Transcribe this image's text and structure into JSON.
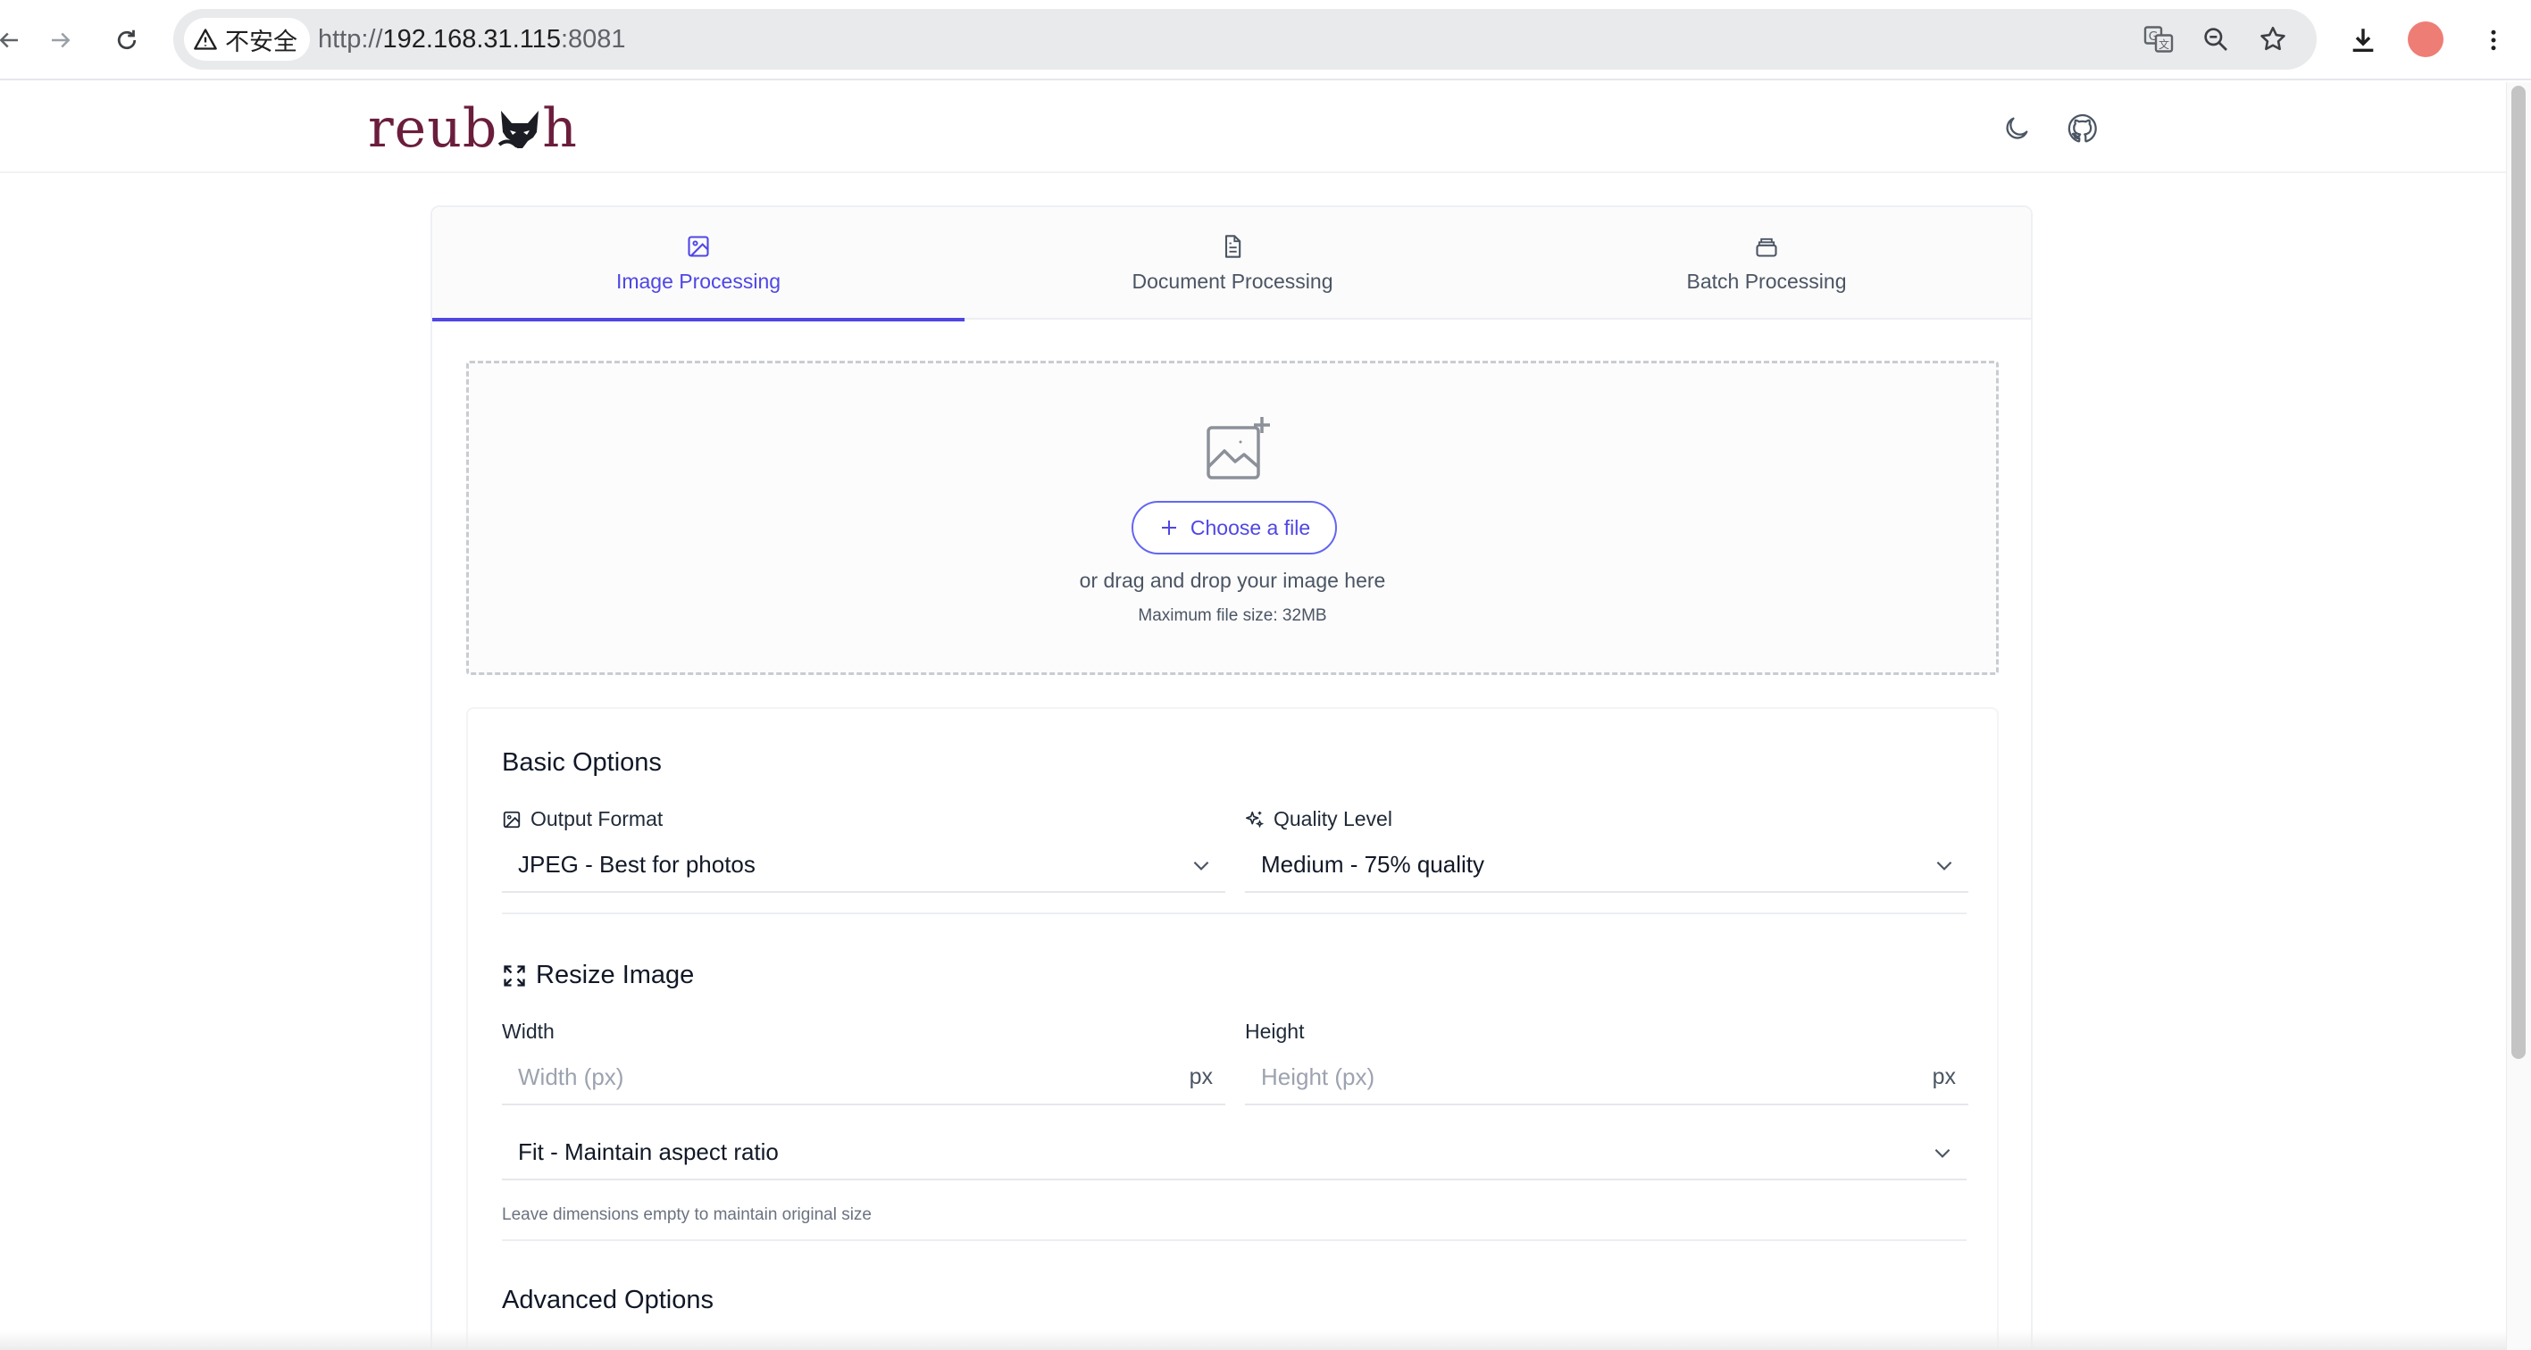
{
  "browser": {
    "security_label": "不安全",
    "url_scheme": "http://",
    "url_host": "192.168.31.115",
    "url_port": ":8081",
    "icons": [
      "back-icon",
      "forward-icon",
      "reload-icon",
      "warning-icon",
      "translate-icon",
      "zoom-icon",
      "bookmark-star-icon",
      "download-icon",
      "profile-avatar",
      "kebab-menu-icon"
    ]
  },
  "header": {
    "logo_left": "reub",
    "logo_right": "h",
    "icons": [
      "moon-icon",
      "github-icon"
    ]
  },
  "tabs": [
    {
      "label": "Image Processing",
      "icon": "image-icon",
      "active": true
    },
    {
      "label": "Document Processing",
      "icon": "document-icon",
      "active": false
    },
    {
      "label": "Batch Processing",
      "icon": "layers-icon",
      "active": false
    }
  ],
  "dropzone": {
    "button_label": "Choose a file",
    "text": "or drag and drop your image here",
    "limit": "Maximum file size: 32MB"
  },
  "basic": {
    "title": "Basic Options",
    "output_format_label": "Output Format",
    "output_format_value": "JPEG - Best for photos",
    "quality_label": "Quality Level",
    "quality_value": "Medium - 75% quality"
  },
  "resize": {
    "title": "Resize Image",
    "width_label": "Width",
    "width_placeholder": "Width (px)",
    "height_label": "Height",
    "height_placeholder": "Height (px)",
    "unit": "px",
    "mode_value": "Fit - Maintain aspect ratio",
    "hint": "Leave dimensions empty to maintain original size"
  },
  "advanced": {
    "title": "Advanced Options"
  },
  "colors": {
    "accent": "#4f46e5",
    "logo": "#6b1d3c",
    "avatar": "#ee7d75"
  }
}
